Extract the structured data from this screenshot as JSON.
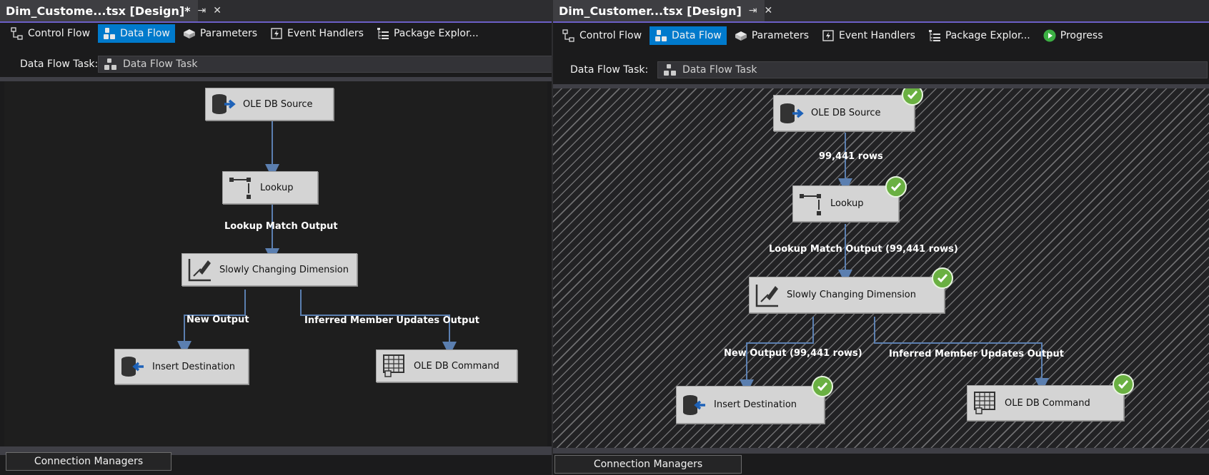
{
  "left": {
    "tab_title": "Dim_Custome...tsx [Design]*",
    "toolbar": {
      "control_flow": "Control Flow",
      "data_flow": "Data Flow",
      "parameters": "Parameters",
      "event_handlers": "Event Handlers",
      "package_explorer": "Package Explor..."
    },
    "task_label": "Data Flow Task:",
    "task_value": "Data Flow Task",
    "components": {
      "source": "OLE DB Source",
      "lookup": "Lookup",
      "scd": "Slowly Changing Dimension",
      "insert": "Insert Destination",
      "command": "OLE DB Command"
    },
    "paths": {
      "lookup_match": "Lookup Match Output",
      "new_output": "New Output",
      "inferred": "Inferred Member Updates Output"
    },
    "connection_managers": "Connection Managers"
  },
  "right": {
    "tab_title": "Dim_Customer...tsx [Design]",
    "toolbar": {
      "control_flow": "Control Flow",
      "data_flow": "Data Flow",
      "parameters": "Parameters",
      "event_handlers": "Event Handlers",
      "package_explorer": "Package Explor...",
      "progress": "Progress"
    },
    "task_label": "Data Flow Task:",
    "task_value": "Data Flow Task",
    "components": {
      "source": "OLE DB Source",
      "lookup": "Lookup",
      "scd": "Slowly Changing Dimension",
      "insert": "Insert Destination",
      "command": "OLE DB Command"
    },
    "paths": {
      "source_rows": "99,441 rows",
      "lookup_match": "Lookup Match Output (99,441 rows)",
      "new_output": "New Output (99,441 rows)",
      "inferred": "Inferred Member Updates Output"
    },
    "connection_managers": "Connection Managers"
  },
  "colors": {
    "active_tab": "#007acc",
    "accent_line": "#6c5fc7",
    "success": "#6ab042",
    "wire": "#5b7fb0"
  }
}
